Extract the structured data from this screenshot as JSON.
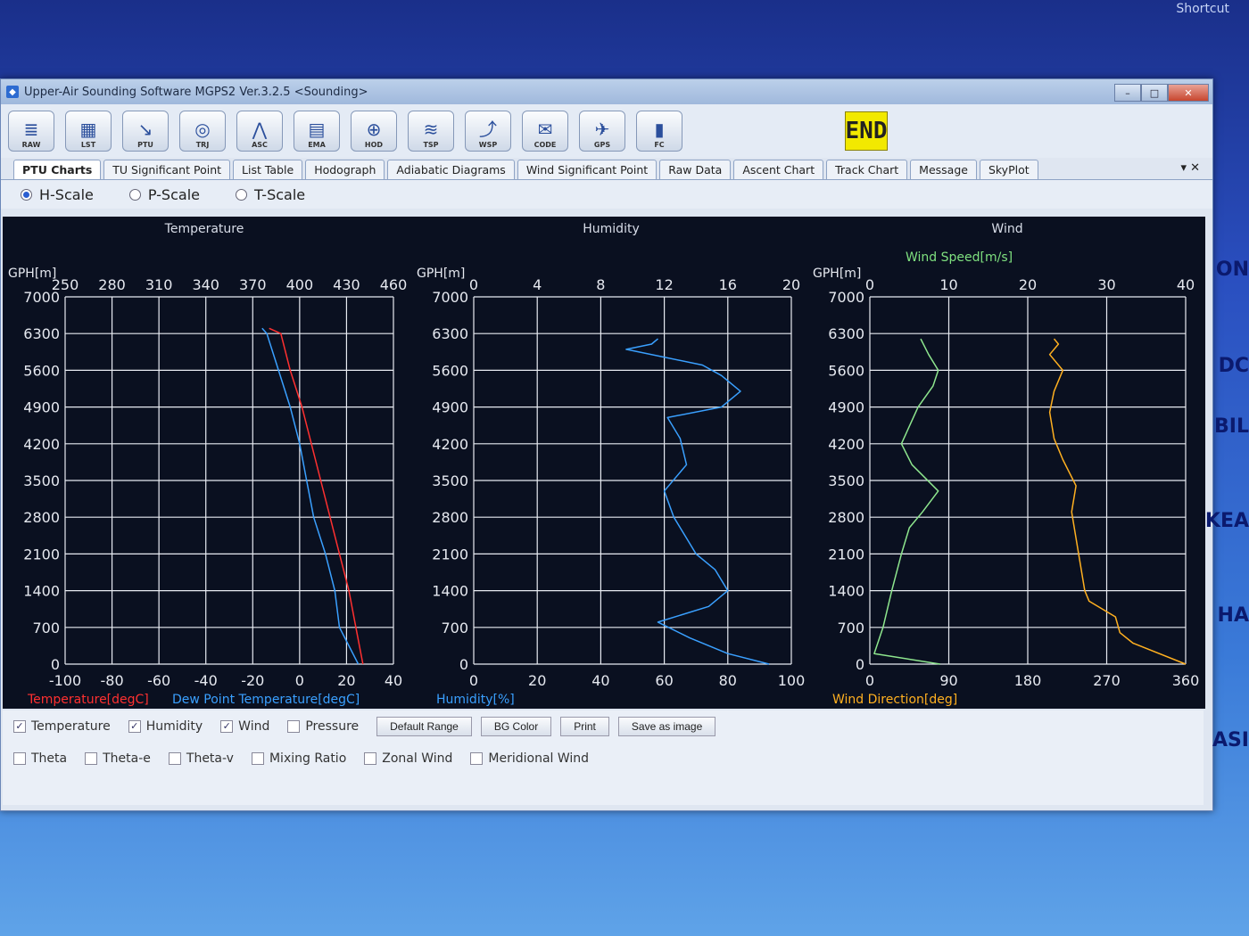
{
  "desktop": {
    "shortcut_label": "Shortcut",
    "edge_texts": [
      "ON",
      "DC",
      "BIL",
      "KEA",
      "HA",
      "ASI"
    ]
  },
  "window": {
    "title": "Upper-Air Sounding Software MGPS2 Ver.3.2.5 <Sounding>",
    "controls": [
      "–",
      "□",
      "✕"
    ]
  },
  "toolbar": {
    "buttons": [
      {
        "label": "RAW",
        "icon": "raw-data-icon",
        "glyph": "≣"
      },
      {
        "label": "LST",
        "icon": "list-table-icon",
        "glyph": "▦"
      },
      {
        "label": "PTU",
        "icon": "ptu-chart-icon",
        "glyph": "↘"
      },
      {
        "label": "TRJ",
        "icon": "trajectory-icon",
        "glyph": "◎"
      },
      {
        "label": "ASC",
        "icon": "ascent-icon",
        "glyph": "⋀"
      },
      {
        "label": "EMA",
        "icon": "ema-icon",
        "glyph": "▤"
      },
      {
        "label": "HOD",
        "icon": "hodograph-icon",
        "glyph": "⊕"
      },
      {
        "label": "TSP",
        "icon": "tsp-icon",
        "glyph": "≋"
      },
      {
        "label": "WSP",
        "icon": "wind-significant-icon",
        "glyph": "⤴"
      },
      {
        "label": "CODE",
        "icon": "message-code-icon",
        "glyph": "✉"
      },
      {
        "label": "GPS",
        "icon": "gps-icon",
        "glyph": "✈"
      },
      {
        "label": "FC",
        "icon": "signal-fc-icon",
        "glyph": "▮"
      }
    ],
    "end_label": "END"
  },
  "tabs": [
    "PTU Charts",
    "TU Significant Point",
    "List Table",
    "Hodograph",
    "Adiabatic Diagrams",
    "Wind Significant Point",
    "Raw Data",
    "Ascent Chart",
    "Track Chart",
    "Message",
    "SkyPlot"
  ],
  "tab_tools": "▾  ✕",
  "scales": [
    {
      "label": "H-Scale",
      "selected": true
    },
    {
      "label": "P-Scale",
      "selected": false
    },
    {
      "label": "T-Scale",
      "selected": false
    }
  ],
  "chart_data": [
    {
      "type": "line",
      "title": "Temperature",
      "ylabel": "GPH[m]",
      "xlabel_bottom": [
        "Temperature[degC]",
        "Dew Point Temperature[degC]"
      ],
      "xlabel_bottom_colors": [
        "#ff3030",
        "#3aa0ff"
      ],
      "top_ticks": [
        "250",
        "280",
        "310",
        "340",
        "370",
        "400",
        "430",
        "460"
      ],
      "bottom_ticks": [
        "-100",
        "-80",
        "-60",
        "-40",
        "-20",
        "0",
        "20",
        "40"
      ],
      "y_ticks": [
        "0",
        "700",
        "1400",
        "2100",
        "2800",
        "3500",
        "4200",
        "4900",
        "5600",
        "6300",
        "7000"
      ],
      "xlim": [
        -100,
        40
      ],
      "ylim": [
        0,
        7000
      ],
      "series": [
        {
          "color": "#ff3030",
          "x": [
            27,
            24,
            21,
            17,
            13,
            9,
            5,
            1,
            -4,
            -8,
            -13
          ],
          "y": [
            0,
            700,
            1400,
            2100,
            2800,
            3500,
            4200,
            4900,
            5600,
            6300,
            6400
          ]
        },
        {
          "color": "#3aa0ff",
          "x": [
            25,
            17,
            15,
            11,
            6,
            3,
            0,
            -4,
            -9,
            -14,
            -16
          ],
          "y": [
            0,
            700,
            1400,
            2100,
            2800,
            3500,
            4200,
            4900,
            5600,
            6300,
            6400
          ]
        }
      ]
    },
    {
      "type": "line",
      "title": "Humidity",
      "ylabel": "GPH[m]",
      "xlabel_bottom": [
        "Humidity[%]"
      ],
      "xlabel_bottom_colors": [
        "#3aa0ff"
      ],
      "top_ticks": [
        "0",
        "4",
        "8",
        "12",
        "16",
        "20"
      ],
      "bottom_ticks": [
        "0",
        "20",
        "40",
        "60",
        "80",
        "100"
      ],
      "y_ticks": [
        "0",
        "700",
        "1400",
        "2100",
        "2800",
        "3500",
        "4200",
        "4900",
        "5600",
        "6300",
        "7000"
      ],
      "xlim": [
        0,
        100
      ],
      "ylim": [
        0,
        7000
      ],
      "series": [
        {
          "color": "#3aa0ff",
          "x": [
            93,
            80,
            68,
            58,
            74,
            80,
            76,
            70,
            66,
            63,
            60,
            67,
            65,
            61,
            78,
            84,
            78,
            72,
            48,
            56,
            57,
            58
          ],
          "y": [
            0,
            200,
            500,
            800,
            1100,
            1400,
            1800,
            2100,
            2500,
            2800,
            3300,
            3800,
            4300,
            4700,
            4900,
            5200,
            5500,
            5700,
            6000,
            6100,
            6150,
            6200
          ]
        }
      ]
    },
    {
      "type": "line",
      "title": "Wind",
      "ylabel": "GPH[m]",
      "toplabel": "Wind Speed[m/s]",
      "toplabel_color": "#7fe07f",
      "xlabel_bottom": [
        "Wind Direction[deg]"
      ],
      "xlabel_bottom_colors": [
        "#ffb020"
      ],
      "top_ticks": [
        "0",
        "10",
        "20",
        "30",
        "40"
      ],
      "bottom_ticks": [
        "0",
        "90",
        "180",
        "270",
        "360"
      ],
      "y_ticks": [
        "0",
        "700",
        "1400",
        "2100",
        "2800",
        "3500",
        "4200",
        "4900",
        "5600",
        "6300",
        "7000"
      ],
      "xlim": [
        0,
        360
      ],
      "ylim": [
        0,
        7000
      ],
      "series": [
        {
          "name": "Wind Speed",
          "color": "#8ee68e",
          "x": [
            80,
            5,
            15,
            25,
            36,
            45,
            60,
            78,
            48,
            36,
            55,
            72,
            78,
            67,
            58
          ],
          "y": [
            0,
            200,
            700,
            1400,
            2100,
            2600,
            2900,
            3300,
            3800,
            4200,
            4900,
            5300,
            5600,
            5900,
            6200
          ]
        },
        {
          "name": "Wind Direction",
          "color": "#ffb020",
          "x": [
            360,
            300,
            285,
            280,
            250,
            245,
            240,
            235,
            230,
            235,
            220,
            210,
            205,
            210,
            220,
            205,
            215,
            210
          ],
          "y": [
            0,
            400,
            600,
            900,
            1200,
            1400,
            1900,
            2400,
            2900,
            3400,
            3900,
            4300,
            4800,
            5200,
            5600,
            5900,
            6100,
            6200
          ]
        }
      ]
    }
  ],
  "options_row1": [
    {
      "label": "Temperature",
      "checked": true
    },
    {
      "label": "Humidity",
      "checked": true
    },
    {
      "label": "Wind",
      "checked": true
    },
    {
      "label": "Pressure",
      "checked": false
    }
  ],
  "buttons_row1": [
    "Default Range",
    "BG Color",
    "Print",
    "Save as image"
  ],
  "options_row2": [
    {
      "label": "Theta",
      "checked": false
    },
    {
      "label": "Theta-e",
      "checked": false
    },
    {
      "label": "Theta-v",
      "checked": false
    },
    {
      "label": "Mixing Ratio",
      "checked": false
    },
    {
      "label": "Zonal Wind",
      "checked": false
    },
    {
      "label": "Meridional Wind",
      "checked": false
    }
  ]
}
